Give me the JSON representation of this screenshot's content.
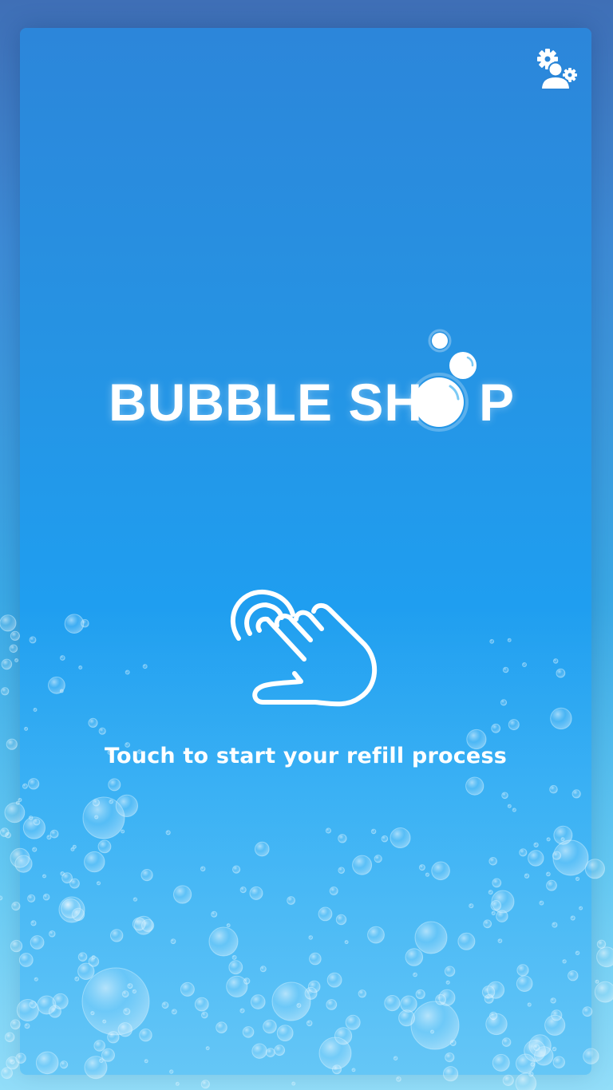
{
  "app": {
    "brand_name": "BUBBLE SHOP",
    "brand_prefix": "BUBBLE SH",
    "brand_suffix": "P"
  },
  "header": {
    "settings_icon": "user-settings-icon"
  },
  "main": {
    "touch_icon": "touch-hand-icon",
    "touch_prompt": "Touch to start your refill process"
  },
  "theme": {
    "accent": "#2393e6",
    "text": "#ffffff"
  }
}
